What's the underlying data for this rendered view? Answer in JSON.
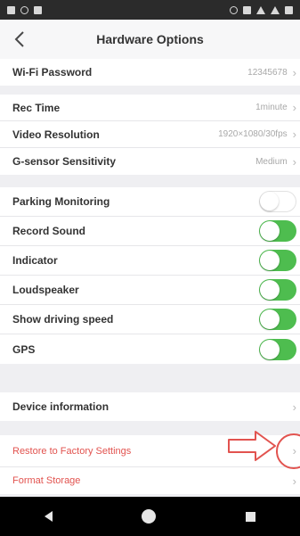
{
  "header": {
    "title": "Hardware Options"
  },
  "wifi": {
    "label": "Wi-Fi Password",
    "value": "12345678"
  },
  "recording": {
    "rec_time": {
      "label": "Rec Time",
      "value": "1minute"
    },
    "video_resolution": {
      "label": "Video Resolution",
      "value": "1920×1080/30fps"
    },
    "gsensor": {
      "label": "G-sensor Sensitivity",
      "value": "Medium"
    }
  },
  "toggles": [
    {
      "label": "Parking Monitoring",
      "on": false
    },
    {
      "label": "Record Sound",
      "on": true
    },
    {
      "label": "Indicator",
      "on": true
    },
    {
      "label": "Loudspeaker",
      "on": true
    },
    {
      "label": "Show driving speed",
      "on": true
    },
    {
      "label": "GPS",
      "on": true
    }
  ],
  "device": {
    "label": "Device information"
  },
  "actions": {
    "restore": "Restore to Factory Settings",
    "format": "Format Storage"
  },
  "colors": {
    "toggle_on": "#4ebd4f",
    "danger": "#e2534f",
    "background": "#efeff2"
  },
  "icons": {
    "back": "chevron-left-icon",
    "row_chevron": "chevron-right-icon",
    "annotation": "arrow-right-icon"
  }
}
